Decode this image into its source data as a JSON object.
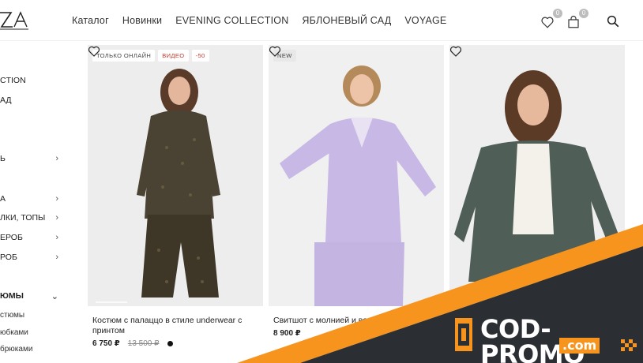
{
  "header": {
    "logo_text": "ZA",
    "nav": [
      "Каталог",
      "Новинки",
      "EVENING COLLECTION",
      "ЯБЛОНЕВЫЙ САД",
      "VOYAGE"
    ],
    "favorites_count": "0",
    "cart_count": "0",
    "icons": [
      "heart-icon",
      "bag-icon",
      "search-icon"
    ]
  },
  "sidebar": {
    "items": [
      {
        "label": "CTION",
        "chevron": ""
      },
      {
        "label": "АД",
        "chevron": ""
      },
      {
        "label": "Ь",
        "chevron": "›"
      },
      {
        "label": "А",
        "chevron": "›"
      },
      {
        "label": "ЛКИ, ТОПЫ",
        "chevron": "›"
      },
      {
        "label": "ЕРОБ",
        "chevron": "›"
      },
      {
        "label": "РОБ",
        "chevron": "›"
      },
      {
        "label": "ЮМЫ",
        "chevron": "⌄"
      }
    ],
    "subitems": [
      "стюмы",
      "юбками",
      "брюками"
    ]
  },
  "products": [
    {
      "badges": [
        "ТОЛЬКО ОНЛАЙН",
        "ВИДЕО",
        "-50"
      ],
      "title": "Костюм с палаццо в стиле underwear с принтом",
      "price": "6 750 ₽",
      "old_price": "13 500 ₽",
      "swatch_color": "#111111"
    },
    {
      "badges": [
        "NEW"
      ],
      "title": "Свитшот с молнией и вор",
      "price": "8 900 ₽",
      "old_price": "",
      "swatch_color": ""
    },
    {
      "badges": [],
      "title": "",
      "price": "",
      "old_price": "",
      "swatch_color": ""
    }
  ],
  "promo": {
    "main": "COD-PROMO",
    "sub": ".com",
    "colors": {
      "dark": "#2b2f33",
      "accent": "#f7941e"
    }
  }
}
